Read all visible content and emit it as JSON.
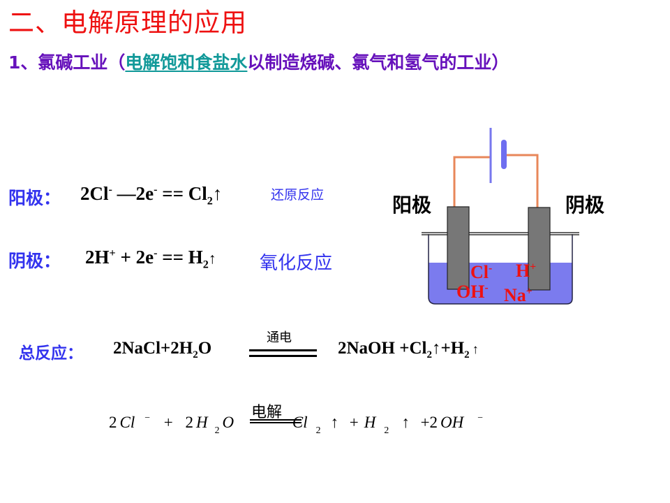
{
  "title": "二、电解原理的应用",
  "subtitle": {
    "prefix": "1、氯碱工业（",
    "link": "电解饱和食盐水",
    "suffix": "以制造烧碱、氯气和氢气的工业）"
  },
  "anode": {
    "label": "阳极：",
    "formula": {
      "a": "2Cl",
      "a_sup": "-",
      "b": " —2e",
      "b_sup": "-",
      "c": " == Cl",
      "c_sub": "2",
      "arrow": "↑"
    },
    "note": "还原反应"
  },
  "cathode": {
    "label": "阴极：",
    "formula": {
      "a": "2H",
      "a_sup": "+",
      "b": " + 2e",
      "b_sup": "-",
      "c": " == H",
      "c_sub": "2",
      "arrow": "↑"
    },
    "note": "氧化反应"
  },
  "diagram": {
    "anode_label": "阳极",
    "cathode_label": "阴极",
    "ions": {
      "cl": "Cl",
      "cl_charge": "-",
      "h": "H",
      "h_charge": "+",
      "oh": "OH",
      "oh_charge": "-",
      "na": "Na",
      "na_charge": "+"
    },
    "colors": {
      "wire": "#e8875a",
      "battery": "#7777ee",
      "electrode": "#777777",
      "solution": "#7b7bee",
      "ion_text": "#ee1111"
    }
  },
  "total": {
    "label": "总反应：",
    "left": "2NaCl+2H",
    "left_sub": "2",
    "left_end": "O",
    "condition": "通电",
    "right_a": "2NaOH +Cl",
    "right_sub1": "2",
    "right_arrow1": "↑",
    "right_b": "+H",
    "right_sub2": "2",
    "right_arrow2": "↑"
  },
  "ionic": {
    "coef1": "2",
    "cl": "Cl",
    "cl_charge": "−",
    "plus1": "+",
    "coef2": "2",
    "h": "H",
    "h_sub": "2",
    "o": "O",
    "condition": "电解",
    "cl2": "Cl",
    "cl2_sub": "2",
    "arrow1": "↑",
    "plus2": "+",
    "h2": "H",
    "h2_sub": "2",
    "arrow2": "↑",
    "plus3": "+",
    "coef3": "2",
    "oh": "OH",
    "oh_charge": "−"
  }
}
